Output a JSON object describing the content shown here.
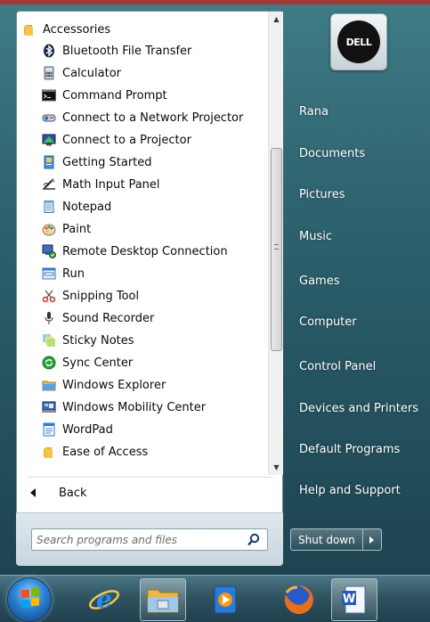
{
  "programs": {
    "folder": "Accessories",
    "items": [
      {
        "label": "Bluetooth File Transfer",
        "icon": "bluetooth-icon"
      },
      {
        "label": "Calculator",
        "icon": "calculator-icon"
      },
      {
        "label": "Command Prompt",
        "icon": "command-prompt-icon"
      },
      {
        "label": "Connect to a Network Projector",
        "icon": "network-projector-icon"
      },
      {
        "label": "Connect to a Projector",
        "icon": "projector-icon"
      },
      {
        "label": "Getting Started",
        "icon": "getting-started-icon"
      },
      {
        "label": "Math Input Panel",
        "icon": "math-input-icon"
      },
      {
        "label": "Notepad",
        "icon": "notepad-icon"
      },
      {
        "label": "Paint",
        "icon": "paint-icon"
      },
      {
        "label": "Remote Desktop Connection",
        "icon": "remote-desktop-icon"
      },
      {
        "label": "Run",
        "icon": "run-icon"
      },
      {
        "label": "Snipping Tool",
        "icon": "snipping-tool-icon"
      },
      {
        "label": "Sound Recorder",
        "icon": "microphone-icon"
      },
      {
        "label": "Sticky Notes",
        "icon": "sticky-notes-icon"
      },
      {
        "label": "Sync Center",
        "icon": "sync-icon"
      },
      {
        "label": "Windows Explorer",
        "icon": "folder-icon"
      },
      {
        "label": "Windows Mobility Center",
        "icon": "mobility-center-icon"
      },
      {
        "label": "WordPad",
        "icon": "wordpad-icon"
      }
    ],
    "subfolder": "Ease of Access"
  },
  "back_label": "Back",
  "search": {
    "placeholder": "Search programs and files"
  },
  "user_tile_logo": "DELL",
  "right_pane": [
    "Rana",
    "Documents",
    "Pictures",
    "Music",
    "Games",
    "Computer",
    "Control Panel",
    "Devices and Printers",
    "Default Programs",
    "Help and Support"
  ],
  "shutdown_label": "Shut down",
  "taskbar": [
    "start-orb-icon",
    "internet-explorer-icon",
    "file-manager-icon",
    "media-player-icon",
    "firefox-icon",
    "word-icon"
  ],
  "colors": {
    "accent": "#2e6370",
    "menu_bg": "#ffffff",
    "text_light": "#ffffff"
  }
}
